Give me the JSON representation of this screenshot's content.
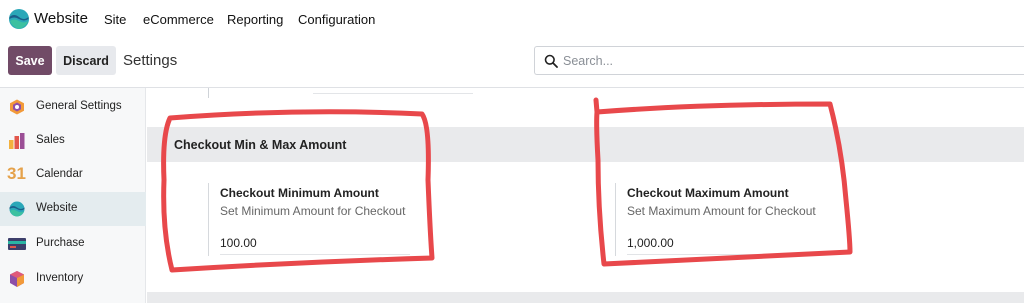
{
  "app": {
    "name": "Website"
  },
  "navbar": {
    "menus": [
      "Site",
      "eCommerce",
      "Reporting",
      "Configuration"
    ]
  },
  "toolbar": {
    "save_label": "Save",
    "discard_label": "Discard",
    "breadcrumb": "Settings"
  },
  "search": {
    "placeholder": "Search...",
    "value": ""
  },
  "sidebar": {
    "items": [
      {
        "label": "General Settings",
        "icon": "general-settings-icon"
      },
      {
        "label": "Sales",
        "icon": "sales-icon"
      },
      {
        "label": "Calendar",
        "icon": "calendar-icon",
        "icon_text": "31"
      },
      {
        "label": "Website",
        "icon": "website-icon",
        "active": true
      },
      {
        "label": "Purchase",
        "icon": "purchase-icon"
      },
      {
        "label": "Inventory",
        "icon": "inventory-icon"
      }
    ]
  },
  "section": {
    "title": "Checkout Min & Max Amount",
    "settings": [
      {
        "title": "Checkout Minimum Amount",
        "description": "Set Minimum Amount for Checkout",
        "value": "100.00"
      },
      {
        "title": "Checkout Maximum Amount",
        "description": "Set Maximum Amount for Checkout",
        "value": "1,000.00"
      }
    ]
  },
  "colors": {
    "primary": "#714b67",
    "highlight": "#e8484b",
    "active_sidebar": "#e4ecef",
    "section_band": "#e9eaec"
  }
}
